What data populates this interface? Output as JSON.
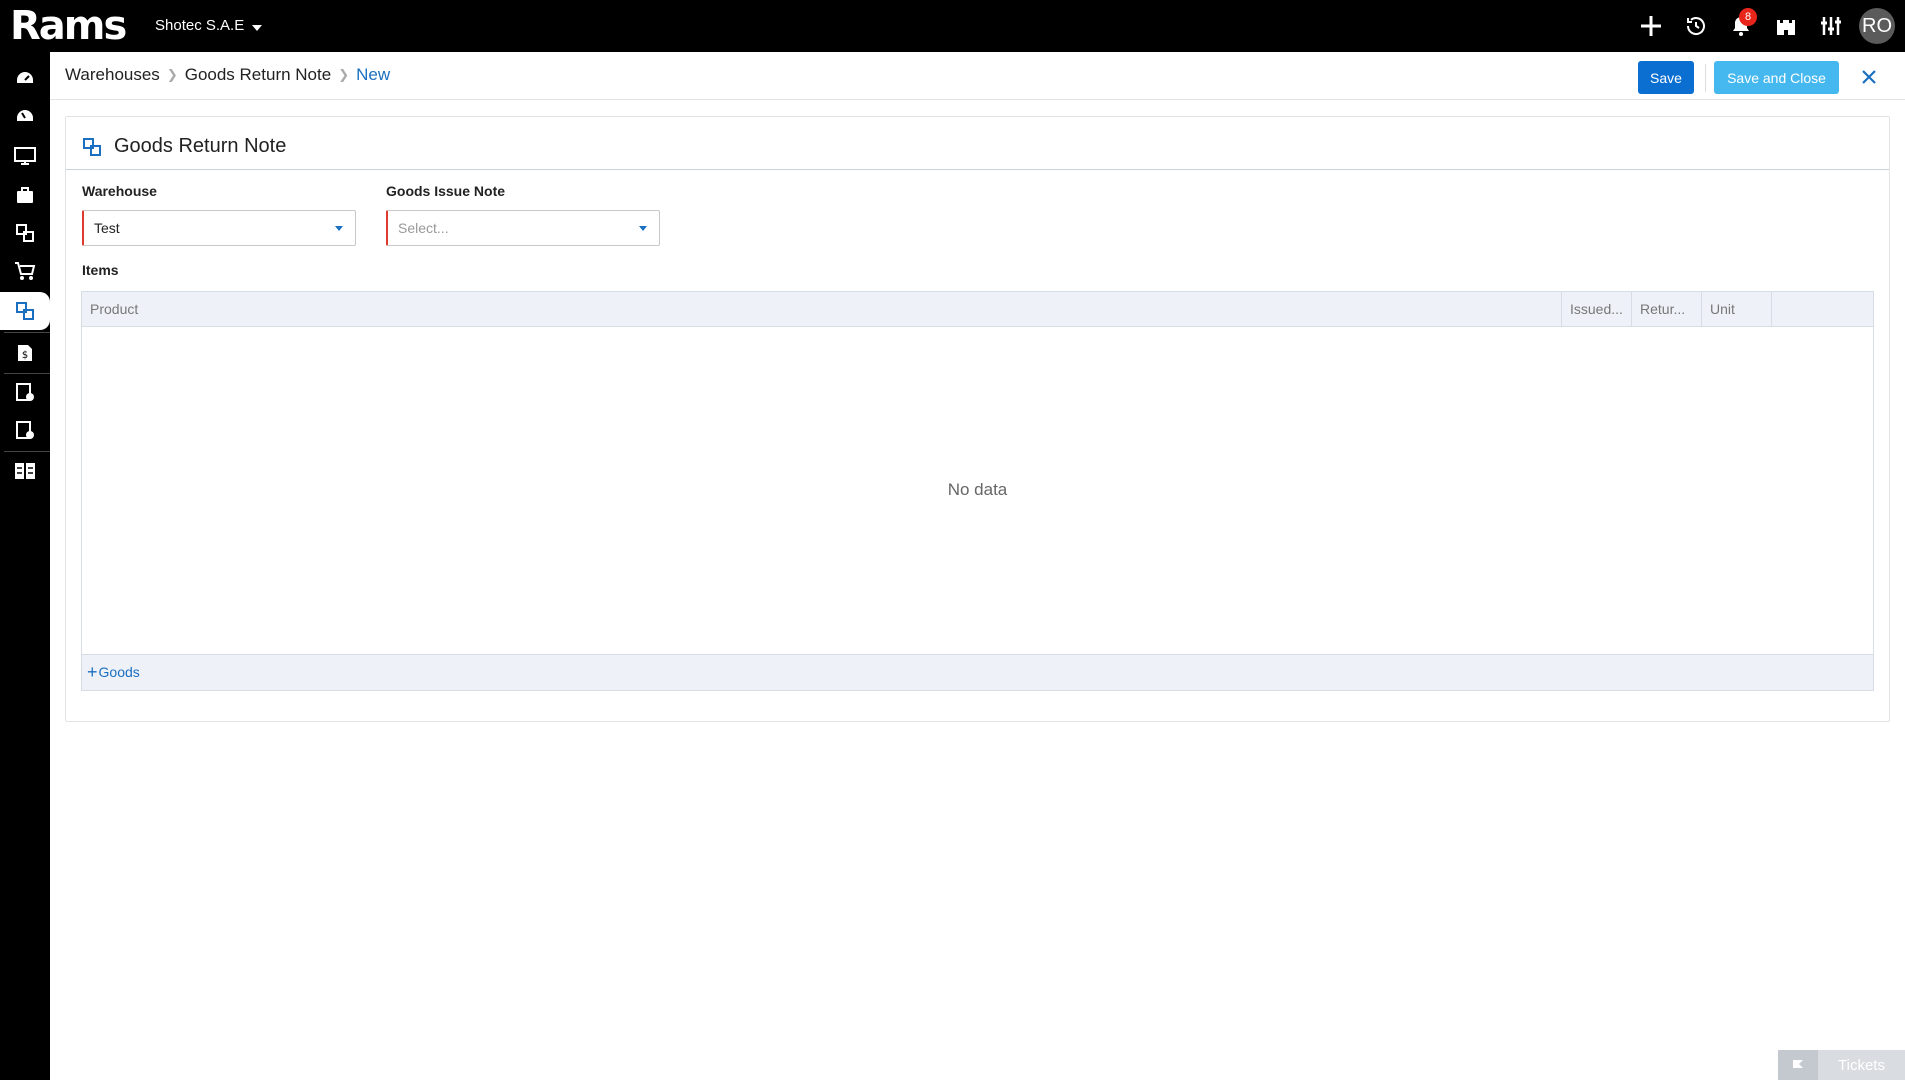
{
  "app": {
    "logo": "Rams",
    "company": "Shotec S.A.E"
  },
  "topbar": {
    "icons": [
      "plus-icon",
      "history-icon",
      "bell-icon",
      "warehouse-icon",
      "sliders-icon"
    ],
    "notification_count": "8",
    "avatar_initials": "RO"
  },
  "sidebar": {
    "items": [
      "dashboard-icon",
      "speedometer-icon",
      "monitor-icon",
      "briefcase-icon",
      "inventory-icon",
      "cart-icon",
      "warehouse-transfer-icon",
      "money-doc-icon",
      "doc-check-icon",
      "doc-settings-icon",
      "grid-doc-icon"
    ],
    "active_index": 6
  },
  "header": {
    "breadcrumb": [
      "Warehouses",
      "Goods Return Note",
      "New"
    ],
    "save_label": "Save",
    "save_close_label": "Save and Close"
  },
  "form": {
    "title": "Goods Return Note",
    "warehouse_label": "Warehouse",
    "warehouse_value": "Test",
    "goods_issue_label": "Goods Issue Note",
    "goods_issue_placeholder": "Select...",
    "items_label": "Items"
  },
  "grid": {
    "columns": [
      "Product",
      "Issued...",
      "Retur...",
      "Unit",
      ""
    ],
    "empty_text": "No data",
    "add_label": "Goods"
  },
  "footer": {
    "tickets_label": "Tickets"
  },
  "colors": {
    "primary": "#0a6fd1",
    "secondary": "#45b8ef",
    "danger": "#e03a2f",
    "link": "#1a6fc0"
  }
}
